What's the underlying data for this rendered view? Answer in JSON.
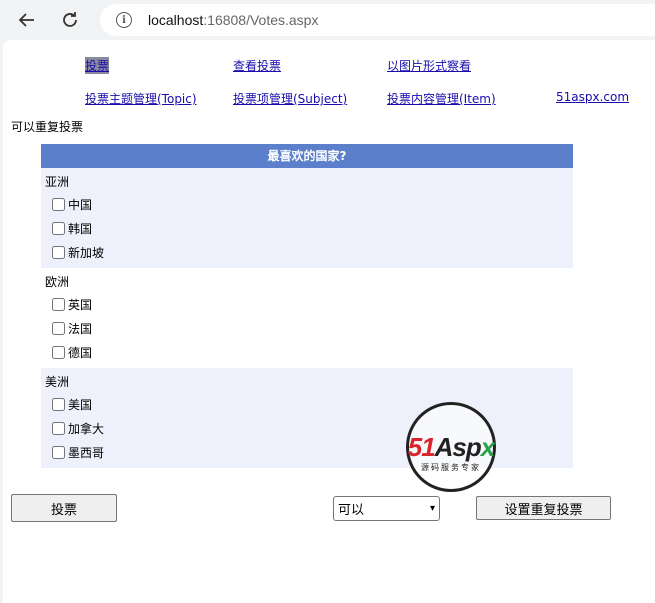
{
  "browser": {
    "url_host": "localhost",
    "url_rest": ":16808/Votes.aspx",
    "info_icon": "info-circle-icon",
    "back_icon": "arrow-left-icon",
    "reload_icon": "reload-icon"
  },
  "nav": {
    "row1": [
      {
        "label": "投票"
      },
      {
        "label": "查看投票"
      },
      {
        "label": "以图片形式察看"
      }
    ],
    "row2": [
      {
        "label": "投票主题管理(Topic)"
      },
      {
        "label": "投票项管理(Subject)"
      },
      {
        "label": "投票内容管理(Item)"
      },
      {
        "label": "51aspx.com"
      }
    ]
  },
  "repeat_note": "可以重复投票",
  "vote": {
    "title": "最喜欢的国家?",
    "groups": [
      {
        "name": "亚洲",
        "options": [
          "中国",
          "韩国",
          "新加坡"
        ]
      },
      {
        "name": "欧洲",
        "options": [
          "英国",
          "法国",
          "德国"
        ]
      },
      {
        "name": "美洲",
        "options": [
          "美国",
          "加拿大",
          "墨西哥"
        ]
      }
    ]
  },
  "actions": {
    "vote_button": "投票",
    "repeat_select_value": "可以",
    "set_repeat_button": "设置重复投票"
  },
  "watermark": {
    "brand_51": "51",
    "brand_asp": "Asp",
    "brand_x": "x",
    "subtitle": "源码服务专家"
  },
  "colors": {
    "header_bg": "#5b7fcb",
    "link": "#1a0dab",
    "group_shade": "#eef1fb"
  }
}
